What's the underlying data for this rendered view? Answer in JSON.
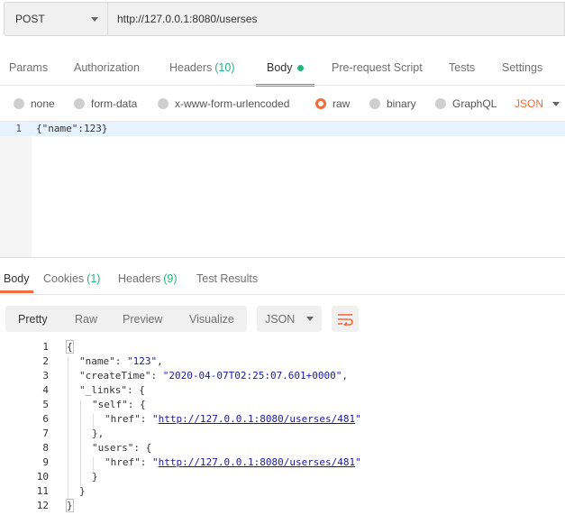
{
  "request": {
    "method": "POST",
    "url": "http://127.0.0.1:8080/userses"
  },
  "request_tabs": [
    {
      "label": "Params"
    },
    {
      "label": "Authorization"
    },
    {
      "label": "Headers",
      "count": "(10)"
    },
    {
      "label": "Body",
      "active": true
    },
    {
      "label": "Pre-request Script"
    },
    {
      "label": "Tests"
    },
    {
      "label": "Settings"
    }
  ],
  "body_types": [
    {
      "label": "none"
    },
    {
      "label": "form-data"
    },
    {
      "label": "x-www-form-urlencoded"
    },
    {
      "label": "raw",
      "selected": true
    },
    {
      "label": "binary"
    },
    {
      "label": "GraphQL"
    }
  ],
  "body_format": "JSON",
  "request_body": {
    "line_number": "1",
    "code": "{\"name\":123}"
  },
  "response_tabs": [
    {
      "label": "Body",
      "active": true
    },
    {
      "label": "Cookies",
      "count": "(1)"
    },
    {
      "label": "Headers",
      "count": "(9)"
    },
    {
      "label": "Test Results"
    }
  ],
  "response_views": [
    "Pretty",
    "Raw",
    "Preview",
    "Visualize"
  ],
  "response_format": "JSON",
  "response_lines": [
    {
      "n": "1",
      "parts": [
        [
          "p",
          "{"
        ]
      ]
    },
    {
      "n": "2",
      "parts": [
        [
          "k",
          "\"name\""
        ],
        [
          "p",
          ": "
        ],
        [
          "s",
          "\"123\""
        ],
        [
          "p",
          ","
        ]
      ]
    },
    {
      "n": "3",
      "parts": [
        [
          "k",
          "\"createTime\""
        ],
        [
          "p",
          ": "
        ],
        [
          "s",
          "\"2020-04-07T02:25:07.601+0000\""
        ],
        [
          "p",
          ","
        ]
      ]
    },
    {
      "n": "4",
      "parts": [
        [
          "k",
          "\"_links\""
        ],
        [
          "p",
          ": {"
        ]
      ]
    },
    {
      "n": "5",
      "parts": [
        [
          "k",
          "\"self\""
        ],
        [
          "p",
          ": {"
        ]
      ]
    },
    {
      "n": "6",
      "parts": [
        [
          "k",
          "\"href\""
        ],
        [
          "p",
          ": "
        ],
        [
          "s",
          "\""
        ],
        [
          "l",
          "http://127.0.0.1:8080/userses/481"
        ],
        [
          "s",
          "\""
        ]
      ]
    },
    {
      "n": "7",
      "parts": [
        [
          "p",
          "},"
        ]
      ]
    },
    {
      "n": "8",
      "parts": [
        [
          "k",
          "\"users\""
        ],
        [
          "p",
          ": {"
        ]
      ]
    },
    {
      "n": "9",
      "parts": [
        [
          "k",
          "\"href\""
        ],
        [
          "p",
          ": "
        ],
        [
          "s",
          "\""
        ],
        [
          "l",
          "http://127.0.0.1:8080/userses/481"
        ],
        [
          "s",
          "\""
        ]
      ]
    },
    {
      "n": "10",
      "parts": [
        [
          "p",
          "}"
        ]
      ]
    },
    {
      "n": "11",
      "parts": [
        [
          "p",
          "}"
        ]
      ]
    },
    {
      "n": "12",
      "parts": [
        [
          "p",
          "}"
        ]
      ]
    }
  ],
  "colors": {
    "accent": "#f26b3a",
    "count_green": "#26b47f",
    "string_blue": "#1a1aa6"
  },
  "icons": {
    "wrap": "wrap-lines-icon",
    "dropdown": "chevron-down-icon"
  }
}
